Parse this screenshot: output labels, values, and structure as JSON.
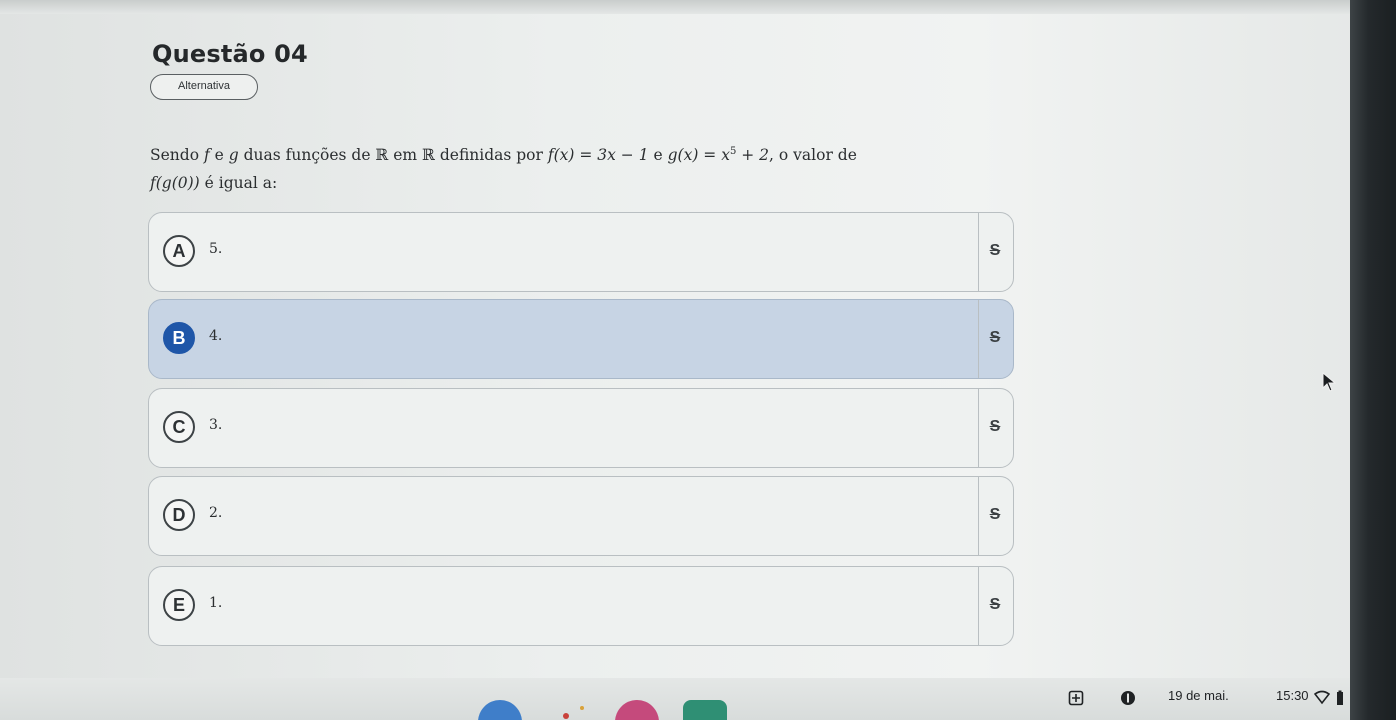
{
  "question": {
    "title": "Questão 04",
    "type_badge": "Alternativa",
    "statement": {
      "p1": "Sendo ",
      "f": "f",
      "p2": " e ",
      "g": "g",
      "p3": " duas funções de ℝ em ℝ definidas por ",
      "fx": "f(x) = 3x − 1",
      "p4": " e ",
      "gx": "g(x) = x",
      "gx_exp": "5",
      "gx_end": " + 2",
      "p5": ", o valor de",
      "fg0": "f(g(0))",
      "p6": " é igual a:"
    }
  },
  "options": [
    {
      "letter": "A",
      "value": "5.",
      "selected": false
    },
    {
      "letter": "B",
      "value": "4.",
      "selected": true
    },
    {
      "letter": "C",
      "value": "3.",
      "selected": false
    },
    {
      "letter": "D",
      "value": "2.",
      "selected": false
    },
    {
      "letter": "E",
      "value": "1.",
      "selected": false
    }
  ],
  "strike_glyph": "S",
  "taskbar": {
    "date": "19 de mai.",
    "time": "15:30"
  },
  "colors": {
    "selected_bg": "#c7d4e4",
    "selected_letter": "#1f56a8"
  }
}
